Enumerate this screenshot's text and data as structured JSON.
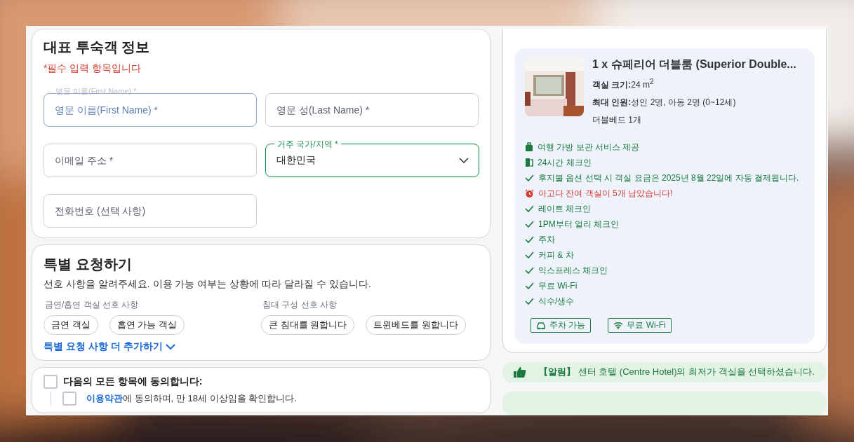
{
  "guest_info": {
    "title": "대표 투숙객 정보",
    "required_note": "*필수 입력 항목입니다",
    "fields": [
      {
        "kind": "text",
        "placeholder": "영문 이름(First Name) *",
        "focused": true,
        "ghost_label": "영문 이름(First Name) *"
      },
      {
        "kind": "text",
        "placeholder": "영문 성(Last Name) *",
        "focused": false
      },
      {
        "kind": "text",
        "placeholder": "이메일 주소 *",
        "focused": false
      },
      {
        "kind": "select",
        "label": "거주 국가/지역 *",
        "value": "대한민국"
      },
      {
        "kind": "text",
        "placeholder": "전화번호 (선택 사항)",
        "focused": false
      }
    ]
  },
  "special_requests": {
    "title": "특별 요청하기",
    "description": "선호 사항을 알려주세요. 이용 가능 여부는 상황에 따라 달라질 수 있습니다.",
    "groups": [
      {
        "label": "금연/흡연 객실 선호 사항",
        "options": [
          {
            "label": "금연 객실",
            "selected": false
          },
          {
            "label": "흡연 가능 객실",
            "selected": false
          }
        ]
      },
      {
        "label": "침대 구성 선호 사항",
        "options": [
          {
            "label": "큰 침대를 원합니다",
            "selected": false
          },
          {
            "label": "트윈베드를 원합니다",
            "selected": false
          }
        ]
      }
    ],
    "more_link": "특별 요청 사항 더 추가하기"
  },
  "agreement": {
    "all": {
      "label": "다음의 모든 항목에 동의합니다:",
      "checked": false
    },
    "items": [
      {
        "link": "이용약관",
        "text": "에 동의하며, 만 18세 이상임을 확인합니다.",
        "checked": false
      }
    ]
  },
  "room": {
    "title": "1 x 슈페리어 더블룸 (Superior Double...",
    "specs": [
      {
        "label": "객실 크기:",
        "value": "24 m$^{2}$"
      },
      {
        "label": "최대 인원:",
        "value": "성인 2명, 아동 2명 (0~12세)"
      }
    ],
    "bed": "더블베드 1개",
    "features": [
      {
        "kind": "luggage",
        "text": "여행 가방 보관 서비스 제공"
      },
      {
        "kind": "door",
        "text": "24시간 체크인"
      },
      {
        "kind": "check",
        "text": "후지불 옵션 선택 시 객실 요금은 2025년 8월 22일에 자동 결제됩니다."
      },
      {
        "kind": "alarm",
        "text": "아고다 잔여 객실이 5개 남았습니다!"
      },
      {
        "kind": "check",
        "text": "레이트 체크인"
      },
      {
        "kind": "check",
        "text": "1PM부터 얼리 체크인"
      },
      {
        "kind": "check",
        "text": "주차"
      },
      {
        "kind": "check",
        "text": "커피 & 차"
      },
      {
        "kind": "check",
        "text": "익스프레스 체크인"
      },
      {
        "kind": "check",
        "text": "무료 Wi-Fi"
      },
      {
        "kind": "check",
        "text": "식수/생수"
      }
    ],
    "badges": [
      {
        "kind": "parking",
        "label": "주차 가능"
      },
      {
        "kind": "wifi",
        "label": "무료 Wi-Fi"
      }
    ]
  },
  "notice": {
    "tag": "【알림】",
    "text": "센터 호텔 (Centre Hotel)의 최저가 객실을 선택하셨습니다."
  }
}
